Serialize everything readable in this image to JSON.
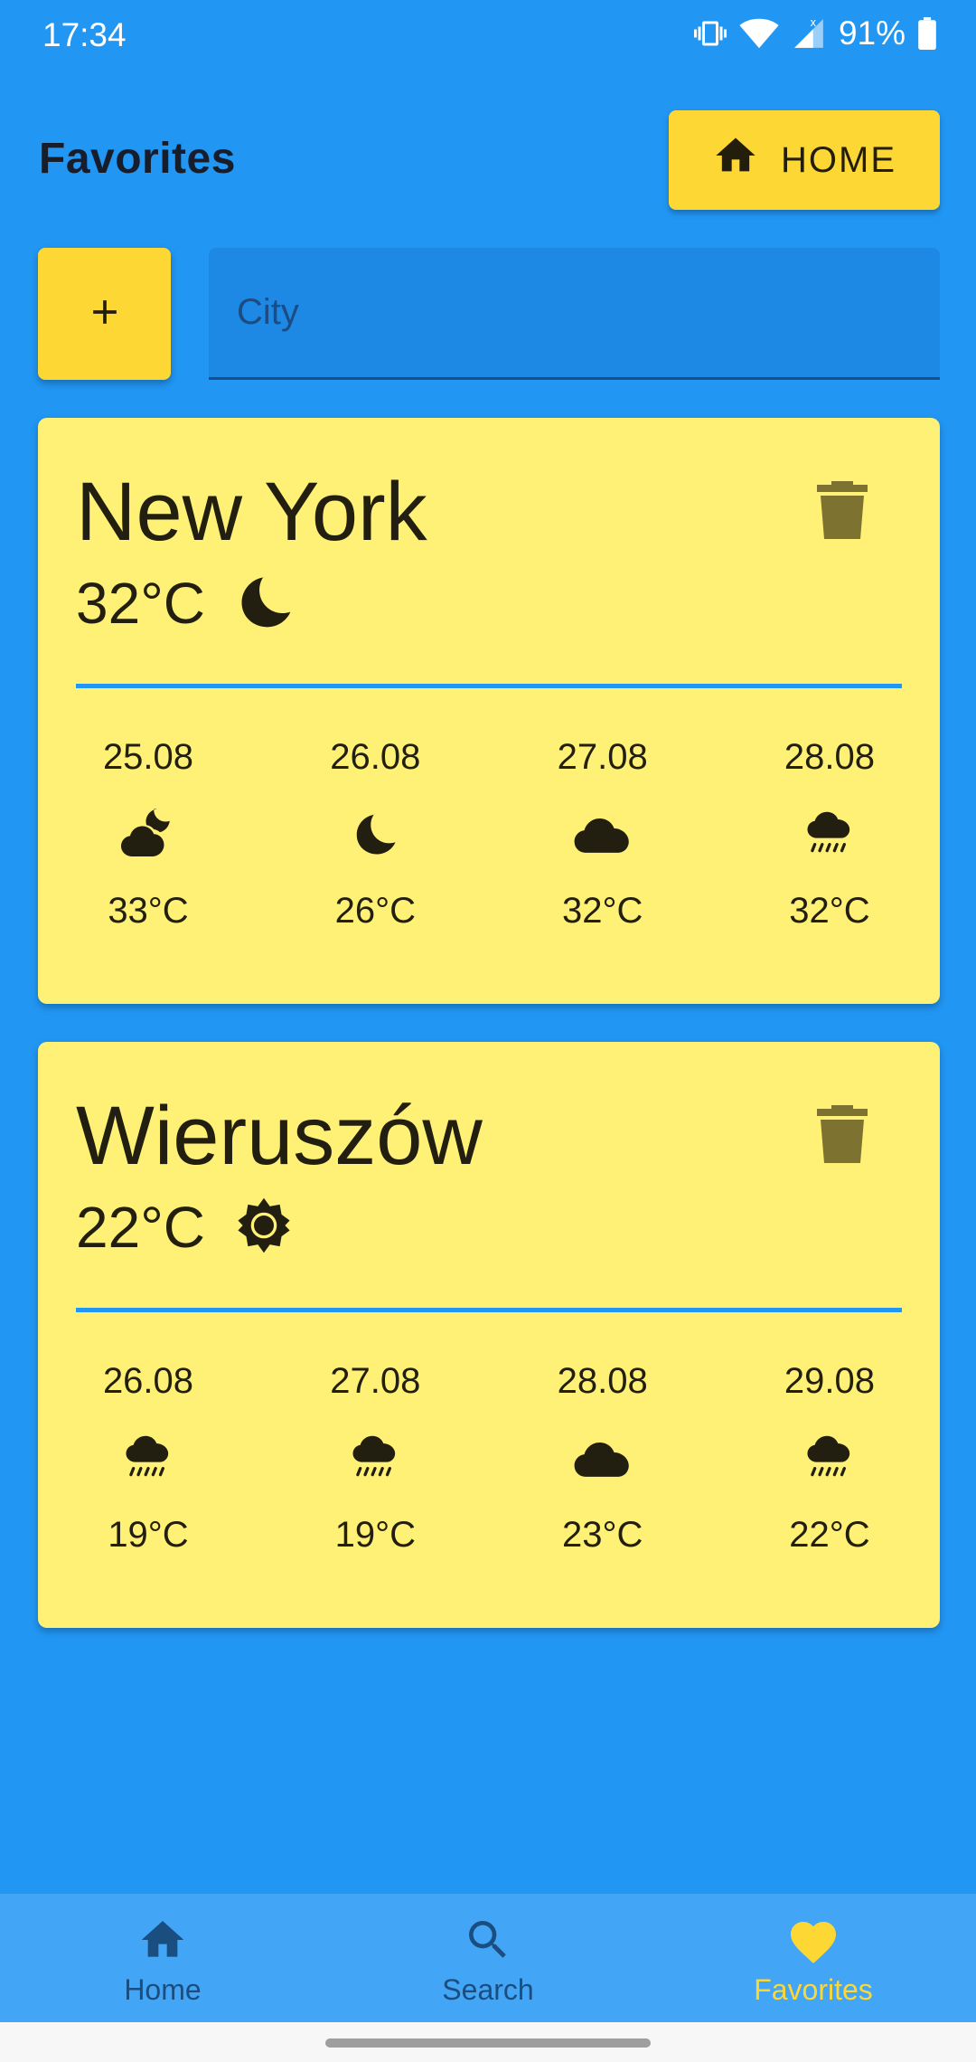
{
  "status_bar": {
    "time": "17:34",
    "battery": "91%",
    "icons": [
      "vibrate-icon",
      "wifi-icon",
      "signal-icon",
      "battery-icon"
    ]
  },
  "header": {
    "title": "Favorites",
    "home_button_label": "HOME",
    "home_icon": "home-icon"
  },
  "add_row": {
    "add_icon": "plus-icon",
    "city_placeholder": "City",
    "city_value": ""
  },
  "colors": {
    "background": "#2196F3",
    "accent": "#FDD835",
    "card": "#FFF176",
    "nav": "#42A5F5"
  },
  "cards": [
    {
      "city": "New York",
      "current_temp": "32°C",
      "current_icon": "moon-icon",
      "delete_icon": "trash-icon",
      "forecast": [
        {
          "date": "25.08",
          "icon": "cloud-moon-icon",
          "temp": "33°C"
        },
        {
          "date": "26.08",
          "icon": "moon-icon",
          "temp": "26°C"
        },
        {
          "date": "27.08",
          "icon": "cloud-icon",
          "temp": "32°C"
        },
        {
          "date": "28.08",
          "icon": "rain-icon",
          "temp": "32°C"
        }
      ]
    },
    {
      "city": "Wieruszów",
      "current_temp": "22°C",
      "current_icon": "sun-icon",
      "delete_icon": "trash-icon",
      "forecast": [
        {
          "date": "26.08",
          "icon": "rain-icon",
          "temp": "19°C"
        },
        {
          "date": "27.08",
          "icon": "rain-icon",
          "temp": "19°C"
        },
        {
          "date": "28.08",
          "icon": "cloud-icon",
          "temp": "23°C"
        },
        {
          "date": "29.08",
          "icon": "rain-icon",
          "temp": "22°C"
        }
      ]
    }
  ],
  "bottom_nav": {
    "items": [
      {
        "label": "Home",
        "icon": "home-icon",
        "active": false
      },
      {
        "label": "Search",
        "icon": "search-icon",
        "active": false
      },
      {
        "label": "Favorites",
        "icon": "heart-icon",
        "active": true
      }
    ]
  }
}
